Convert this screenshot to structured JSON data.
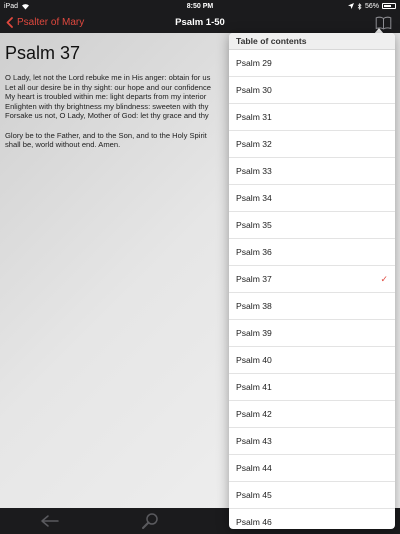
{
  "status_bar": {
    "carrier": "iPad",
    "time": "8:50 PM",
    "battery": "56%",
    "battery_level": 0.56
  },
  "nav": {
    "back_label": "Psalter of Mary",
    "title": "Psalm 1-50",
    "right_icon": "book-icon"
  },
  "psalm": {
    "title": "Psalm 37",
    "lines": [
      "O Lady, let not the Lord rebuke me in His anger: obtain for us",
      "Let all our desire be in thy sight: our hope and our confidence",
      "My heart is troubled within me: light departs from my interior",
      "Enlighten with thy brightness my blindness: sweeten with thy",
      "Forsake us not, O Lady, Mother of God: let thy grace and thy"
    ],
    "doxology": [
      "Glory be to the Father, and to the Son, and to the Holy Spirit",
      "shall be, world without end. Amen."
    ]
  },
  "toc": {
    "header": "Table of contents",
    "selected_index": 8,
    "items": [
      "Psalm 29",
      "Psalm 30",
      "Psalm 31",
      "Psalm 32",
      "Psalm 33",
      "Psalm 34",
      "Psalm 35",
      "Psalm 36",
      "Psalm 37",
      "Psalm 38",
      "Psalm 39",
      "Psalm 40",
      "Psalm 41",
      "Psalm 42",
      "Psalm 43",
      "Psalm 44",
      "Psalm 45",
      "Psalm 46"
    ]
  },
  "tab_bar": {
    "icons": [
      "back-arrow-icon",
      "search-icon",
      "cloud-icon",
      "share-icon"
    ]
  },
  "colors": {
    "accent": "#e0483e",
    "bar_background": "#1b1b1d"
  }
}
